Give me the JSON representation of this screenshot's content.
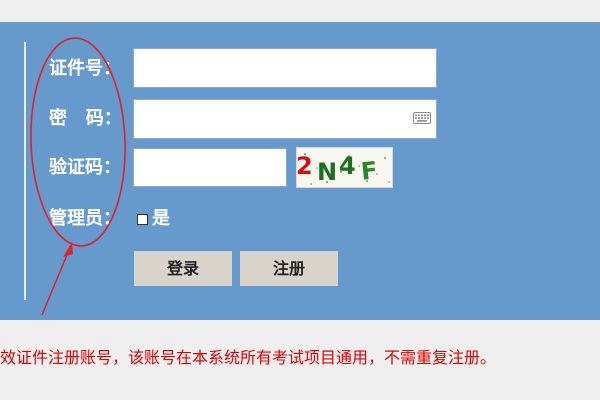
{
  "form": {
    "id_label": "证件号：",
    "password_label": "密   码：",
    "captcha_label": "验证码：",
    "admin_label": "管理员：",
    "admin_option": "是",
    "id_value": "",
    "password_value": "",
    "captcha_value": ""
  },
  "captcha_image": {
    "chars": [
      "2",
      "N",
      "4",
      "F"
    ]
  },
  "buttons": {
    "login": "登录",
    "register": "注册"
  },
  "notice": "效证件注册账号，该账号在本系统所有考试项目通用，不需重复注册。",
  "icons": {
    "keyboard": "keyboard-icon"
  },
  "colors": {
    "panel_bg": "#6699cc",
    "page_bg": "#efefef",
    "notice_text": "#e00000",
    "annotation_red": "#e0202a",
    "button_bg": "#d8d4cc"
  }
}
